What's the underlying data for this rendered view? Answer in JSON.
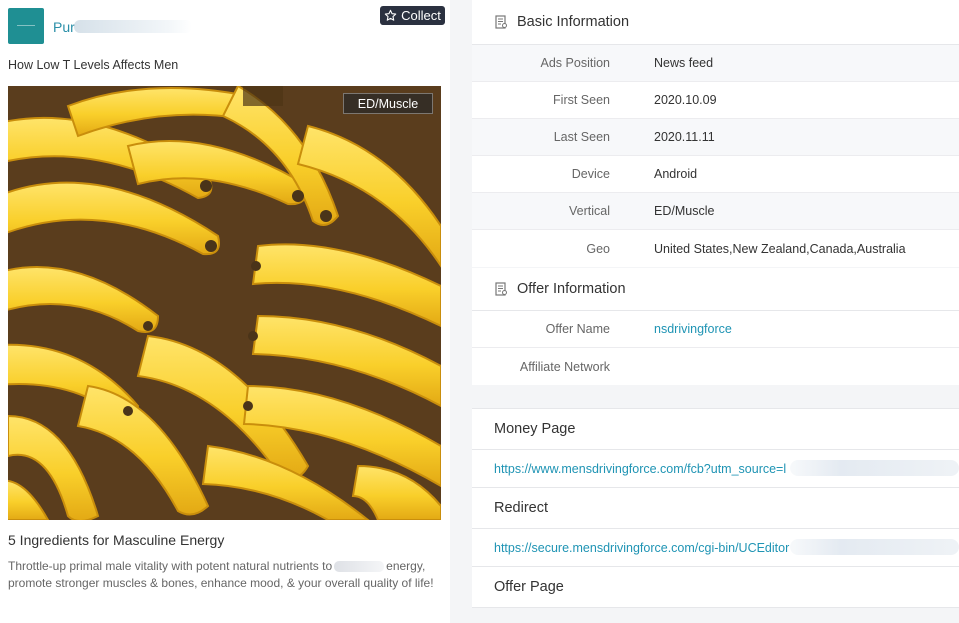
{
  "ad": {
    "page_name": "Pur",
    "collect_label": "Collect",
    "headline": "How Low T Levels Affects Men",
    "vertical_tag": "ED/Muscle",
    "title": "5 Ingredients for Masculine Energy",
    "description_part1": "Throttle-up primal male vitality with potent natural nutrients to",
    "description_part2": "energy, promote stronger muscles & bones, enhance mood, & your overall quality of life!",
    "brand_color": "#1f8f93"
  },
  "basic_info": {
    "title": "Basic Information",
    "icon": "document-icon",
    "rows": [
      {
        "label": "Ads Position",
        "value": "News feed"
      },
      {
        "label": "First Seen",
        "value": "2020.10.09"
      },
      {
        "label": "Last Seen",
        "value": "2020.11.11"
      },
      {
        "label": "Device",
        "value": "Android"
      },
      {
        "label": "Vertical",
        "value": "ED/Muscle"
      },
      {
        "label": "Geo",
        "value": "United States,New Zealand,Canada,Australia"
      }
    ]
  },
  "offer_info": {
    "title": "Offer Information",
    "icon": "document-icon",
    "rows": [
      {
        "label": "Offer Name",
        "value": "nsdrivingforce"
      },
      {
        "label": "Affiliate Network",
        "value": ""
      }
    ]
  },
  "money_page": {
    "title": "Money Page",
    "url": "https://www.mensdrivingforce.com/fcb?utm_source=l"
  },
  "redirect": {
    "title": "Redirect",
    "url": "https://secure.mensdrivingforce.com/cgi-bin/UCEditor"
  },
  "offer_page": {
    "title": "Offer Page"
  },
  "colors": {
    "link": "#1f94b4",
    "collect_bg": "#2b3140"
  }
}
